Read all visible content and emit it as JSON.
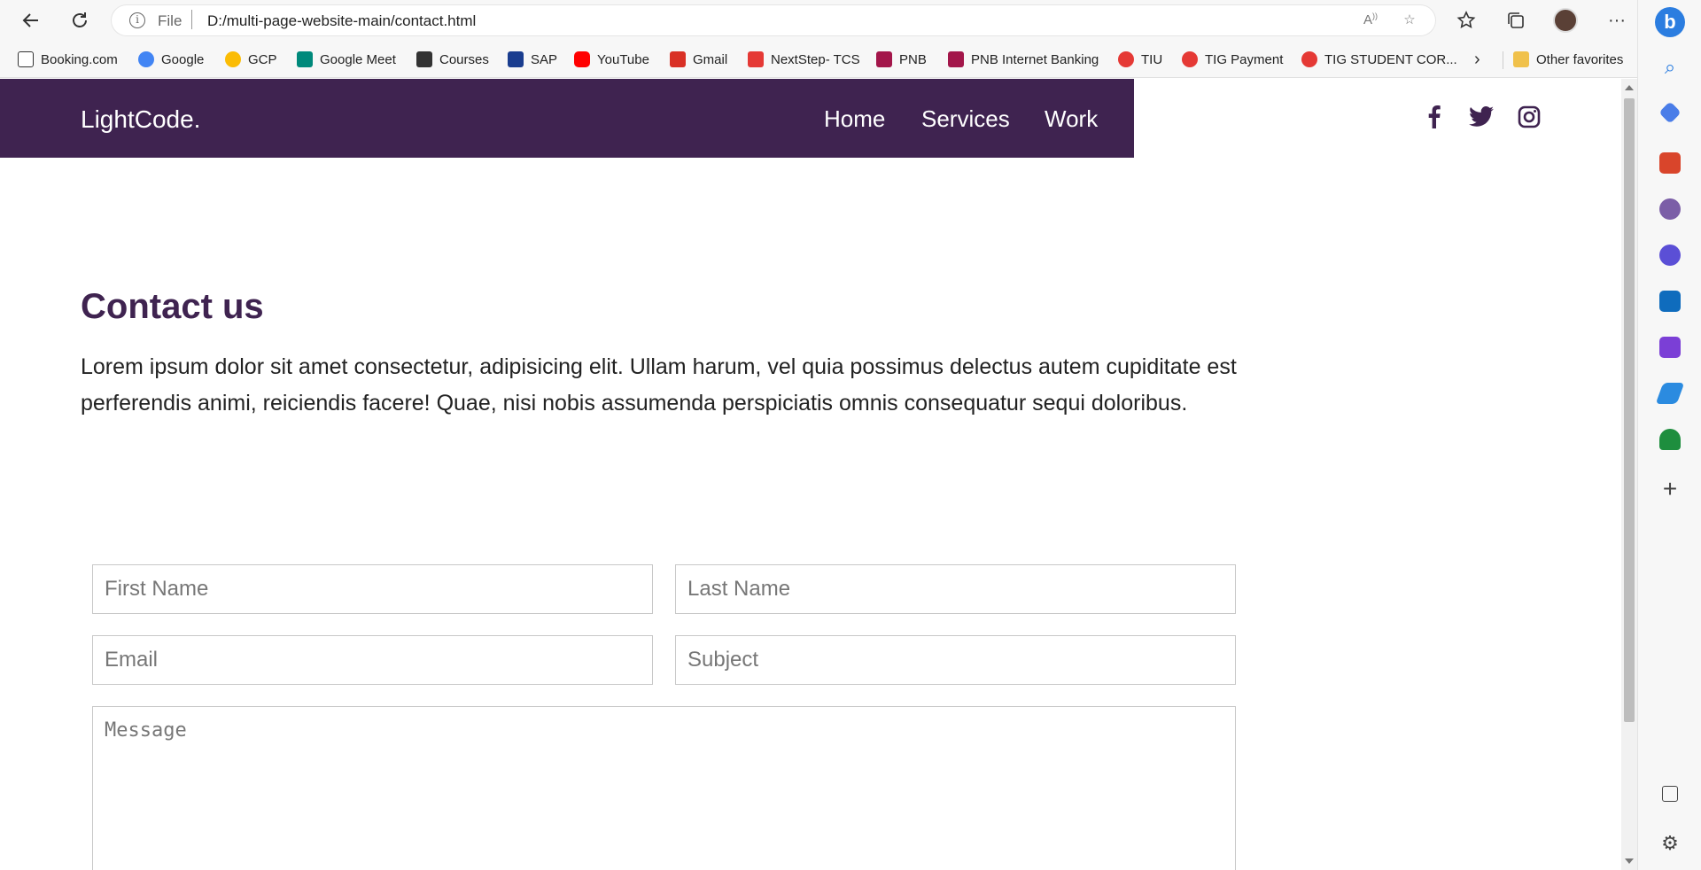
{
  "browser": {
    "scheme": "File",
    "url": "D:/multi-page-website-main/contact.html",
    "bookmarks": [
      {
        "label": "Booking.com",
        "color": "#1e3a7b"
      },
      {
        "label": "Google",
        "color": "#4285f4"
      },
      {
        "label": "GCP",
        "color": "#4285f4"
      },
      {
        "label": "Google Meet",
        "color": "#00897b"
      },
      {
        "label": "Courses",
        "color": "#333333"
      },
      {
        "label": "SAP",
        "color": "#1a3d8f"
      },
      {
        "label": "YouTube",
        "color": "#ff0000"
      },
      {
        "label": "Gmail",
        "color": "#d93025"
      },
      {
        "label": "NextStep- TCS",
        "color": "#e53935"
      },
      {
        "label": "PNB",
        "color": "#a3164a"
      },
      {
        "label": "PNB Internet Banking",
        "color": "#a3164a"
      },
      {
        "label": "TIU",
        "color": "#e53935"
      },
      {
        "label": "TIG Payment",
        "color": "#e53935"
      },
      {
        "label": "TIG STUDENT COR...",
        "color": "#e53935"
      }
    ],
    "other_favorites": "Other favorites"
  },
  "site": {
    "logo": "LightCode.",
    "nav": [
      "Home",
      "Services",
      "Work"
    ],
    "brand_color": "#3f2350",
    "social_icons": [
      "facebook-icon",
      "twitter-icon",
      "instagram-icon"
    ]
  },
  "contact": {
    "title": "Contact us",
    "text": "Lorem ipsum dolor sit amet consectetur, adipisicing elit. Ullam harum, vel quia possimus delectus autem cupiditate est perferendis animi, reiciendis facere! Quae, nisi nobis assumenda perspiciatis omnis consequatur sequi doloribus.",
    "form": {
      "first_name": "First Name",
      "last_name": "Last Name",
      "email": "Email",
      "subject": "Subject",
      "message": "Message"
    }
  }
}
